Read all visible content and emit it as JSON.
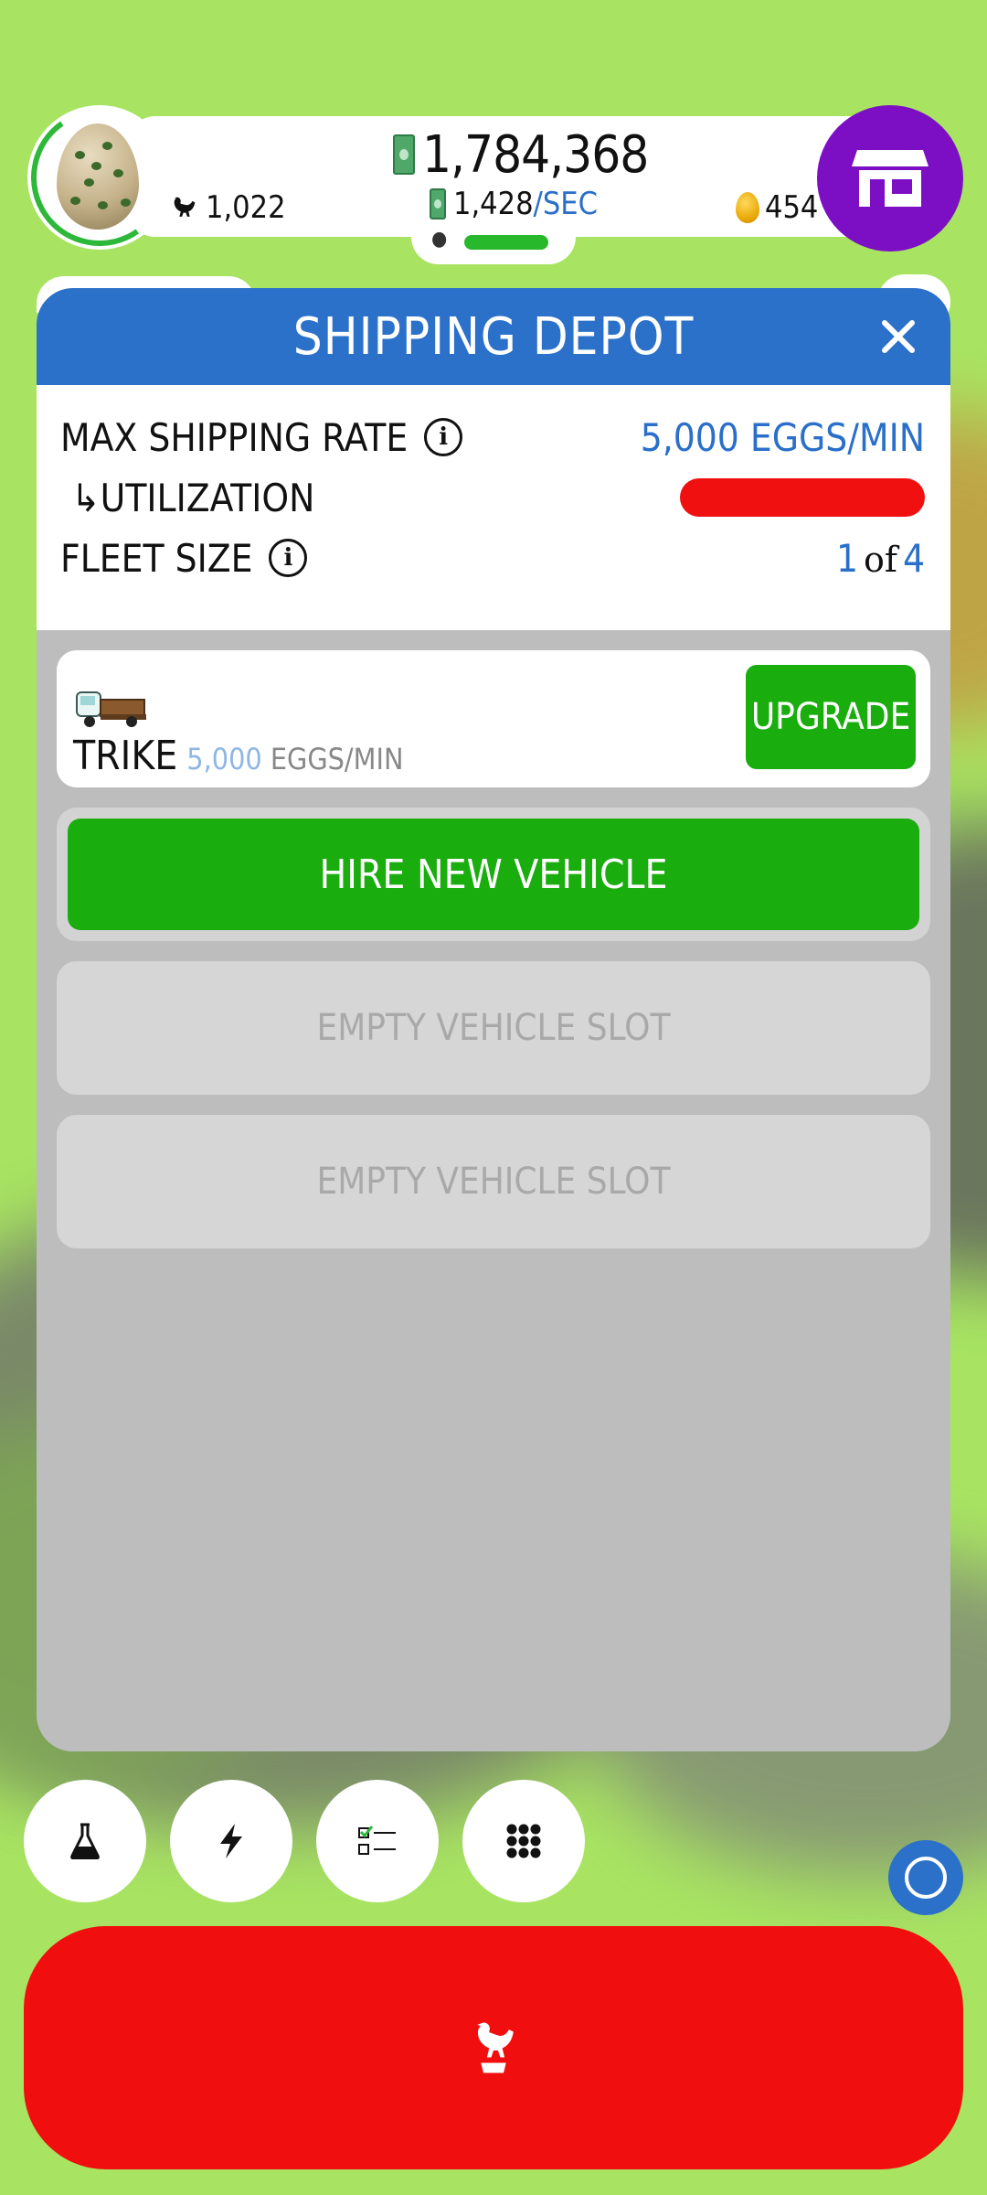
{
  "hud": {
    "money": "1,784,368",
    "rate_value": "1,428",
    "rate_unit": "/SEC",
    "chickens": "1,022",
    "golden_eggs": "454"
  },
  "modal": {
    "title": "SHIPPING DEPOT",
    "stats": {
      "max_rate_label": "MAX SHIPPING RATE",
      "max_rate_value": "5,000 EGGS/MIN",
      "utilization_label": "↳UTILIZATION",
      "utilization_fraction": 1.0,
      "fleet_label": "FLEET SIZE",
      "fleet_current": "1",
      "fleet_of": "of",
      "fleet_max": "4"
    },
    "vehicle": {
      "name": "TRIKE",
      "rate_num": "5,000",
      "rate_unit": "EGGS/MIN",
      "upgrade_label": "UPGRADE"
    },
    "hire_label": "HIRE NEW VEHICLE",
    "empty_slots": [
      "EMPTY VEHICLE SLOT",
      "EMPTY VEHICLE SLOT"
    ]
  },
  "colors": {
    "background": "#a8e462",
    "header_blue": "#2b70c9",
    "action_green": "#19ad0d",
    "danger_red": "#f01010",
    "shop_purple": "#7c0fc4"
  },
  "toolbar": {
    "icons": [
      "flask-icon",
      "lightning-icon",
      "checklist-icon",
      "grid-icon"
    ]
  }
}
